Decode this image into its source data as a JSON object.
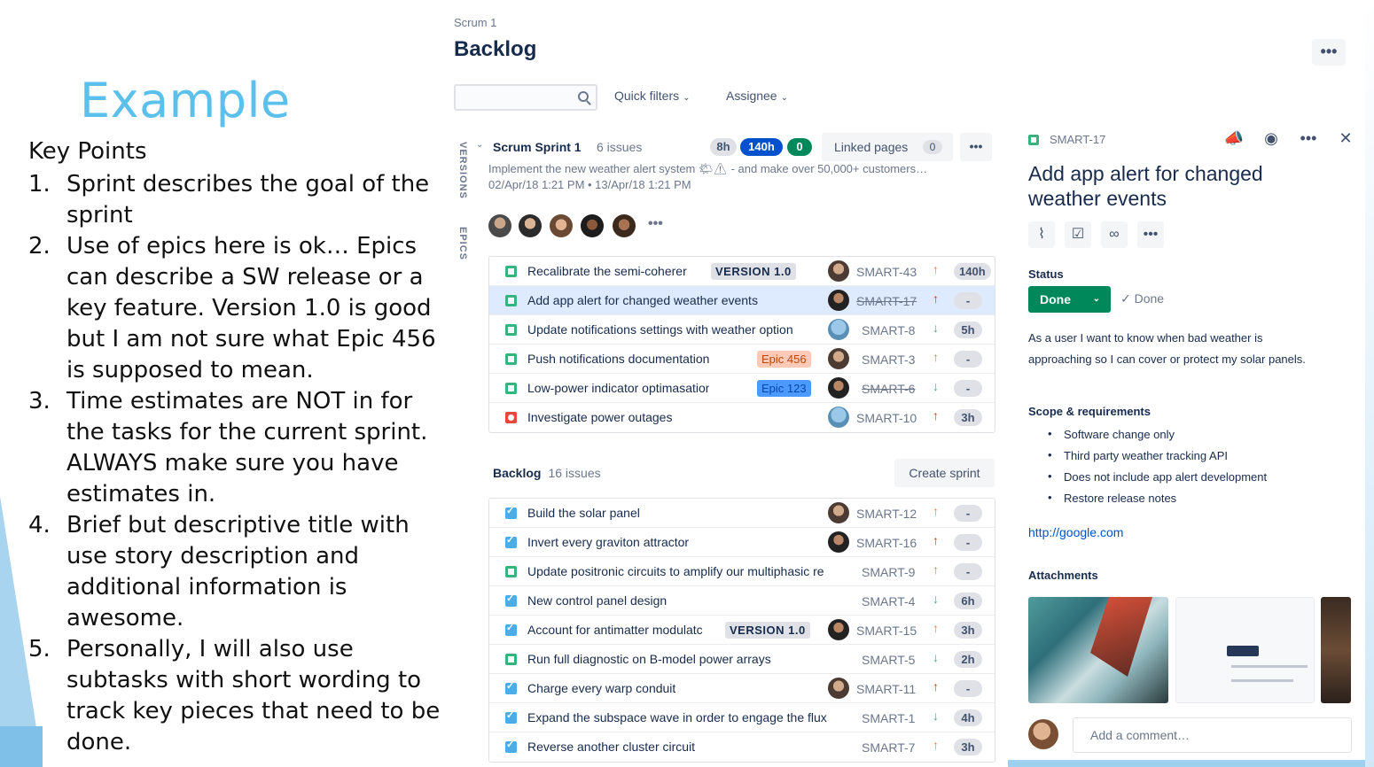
{
  "slide": {
    "title": "Example",
    "subtitle": "Key Points",
    "points": [
      {
        "num": "1.",
        "text": "Sprint describes the goal of the sprint"
      },
      {
        "num": "2.",
        "text": "Use of epics here is ok… Epics can describe a SW release or a key feature. Version 1.0 is good but I am not sure what Epic 456 is supposed to mean."
      },
      {
        "num": "3.",
        "text": "Time estimates are NOT in for the tasks for the current sprint. ALWAYS make sure you have estimates in."
      },
      {
        "num": "4.",
        "text": "Brief but descriptive title with use story description and additional information is awesome."
      },
      {
        "num": "5.",
        "text": "Personally, I will also use subtasks with short wording to track key pieces that need to be done."
      }
    ]
  },
  "board": {
    "breadcrumb": "Scrum 1",
    "title": "Backlog",
    "more": "•••",
    "search_placeholder": "",
    "filters": {
      "quick": "Quick filters",
      "assignee": "Assignee"
    },
    "side_tabs": {
      "versions": "VERSIONS",
      "epics": "EPICS"
    }
  },
  "sprint": {
    "name": "Scrum Sprint 1",
    "count": "6 issues",
    "pills": {
      "todo": "8h",
      "progress": "140h",
      "done": "0"
    },
    "linked_pages": "Linked pages",
    "linked_count": "0",
    "more": "•••",
    "goal": "Implement the new weather alert system 🌤⚠ - and make over 50,000+ customers…",
    "dates": "02/Apr/18 1:21 PM • 13/Apr/18 1:21 PM",
    "avatars_more": "•••",
    "issues": [
      {
        "type": "story",
        "summary": "Recalibrate the semi-coherer",
        "tag": "VERSION 1.0",
        "tag_kind": "version",
        "key": "SMART-43",
        "priority": "med",
        "estimate": "140h",
        "done": false
      },
      {
        "type": "story",
        "summary": "Add app alert for changed weather events",
        "tag": "",
        "tag_kind": "",
        "key": "SMART-17",
        "priority": "high",
        "estimate": "-",
        "done": true,
        "selected": true
      },
      {
        "type": "story",
        "summary": "Update notifications settings with weather option",
        "tag": "",
        "tag_kind": "",
        "key": "SMART-8",
        "priority": "low",
        "estimate": "5h",
        "done": false
      },
      {
        "type": "story",
        "summary": "Push notifications documentation upc",
        "tag": "Epic 456",
        "tag_kind": "epic-orange",
        "key": "SMART-3",
        "priority": "med",
        "estimate": "-",
        "done": false
      },
      {
        "type": "story",
        "summary": "Low-power indicator optimasation on",
        "tag": "Epic 123",
        "tag_kind": "epic-blue",
        "key": "SMART-6",
        "priority": "low",
        "estimate": "-",
        "done": true
      },
      {
        "type": "bug",
        "summary": "Investigate power outages",
        "tag": "",
        "tag_kind": "",
        "key": "SMART-10",
        "priority": "high",
        "estimate": "3h",
        "done": false
      }
    ]
  },
  "backlog": {
    "name": "Backlog",
    "count": "16 issues",
    "create_sprint": "Create sprint",
    "issues": [
      {
        "type": "task",
        "summary": "Build the solar panel",
        "tag": "",
        "tag_kind": "",
        "key": "SMART-12",
        "priority": "med",
        "estimate": "-",
        "avatar": true
      },
      {
        "type": "task",
        "summary": "Invert every graviton attractor",
        "tag": "",
        "tag_kind": "",
        "key": "SMART-16",
        "priority": "high",
        "estimate": "-",
        "avatar": true
      },
      {
        "type": "story",
        "summary": "Update positronic circuits to amplify our multiphasic re",
        "tag": "",
        "tag_kind": "",
        "key": "SMART-9",
        "priority": "med",
        "estimate": "-",
        "avatar": false
      },
      {
        "type": "task",
        "summary": "New control panel design",
        "tag": "",
        "tag_kind": "",
        "key": "SMART-4",
        "priority": "low",
        "estimate": "6h",
        "avatar": false
      },
      {
        "type": "task",
        "summary": "Account for antimatter modulatc",
        "tag": "VERSION 1.0",
        "tag_kind": "version",
        "key": "SMART-15",
        "priority": "med",
        "estimate": "3h",
        "avatar": true
      },
      {
        "type": "story",
        "summary": "Run full diagnostic on B-model power arrays",
        "tag": "",
        "tag_kind": "",
        "key": "SMART-5",
        "priority": "low",
        "estimate": "2h",
        "avatar": false
      },
      {
        "type": "task",
        "summary": "Charge every warp conduit",
        "tag": "",
        "tag_kind": "",
        "key": "SMART-11",
        "priority": "high",
        "estimate": "-",
        "avatar": true
      },
      {
        "type": "task",
        "summary": "Expand the subspace wave in order to engage the flux",
        "tag": "",
        "tag_kind": "",
        "key": "SMART-1",
        "priority": "low",
        "estimate": "4h",
        "avatar": false
      },
      {
        "type": "task",
        "summary": "Reverse another cluster circuit",
        "tag": "",
        "tag_kind": "",
        "key": "SMART-7",
        "priority": "med",
        "estimate": "3h",
        "avatar": false
      }
    ]
  },
  "detail": {
    "key": "SMART-17",
    "title": "Add app alert for changed weather events",
    "status_label": "Status",
    "status": "Done",
    "resolution": "✓ Done",
    "description": "As a user I want to know when bad weather is approaching so I can cover or protect my solar panels.",
    "scope_label": "Scope & requirements",
    "scope": [
      "Software change only",
      "Third party weather tracking API",
      "Does not include app alert development",
      "Restore release notes"
    ],
    "link": "http://google.com",
    "attachments_label": "Attachments",
    "comment_placeholder": "Add a comment…"
  },
  "colors": {
    "accent": "#0052cc",
    "done_green": "#00875a",
    "slide_title": "#5bc0eb",
    "priority_high": "#de350b",
    "priority_medium": "#ff7452",
    "priority_low": "#36b37e"
  }
}
